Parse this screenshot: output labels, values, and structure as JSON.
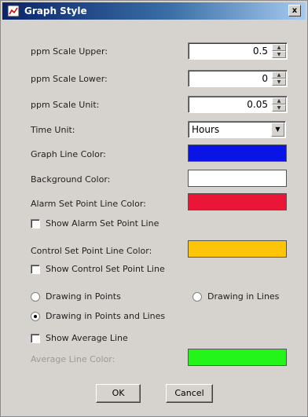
{
  "window": {
    "title": "Graph Style",
    "close_symbol": "x"
  },
  "fields": {
    "ppm_upper": {
      "label": "ppm Scale Upper:",
      "value": "0.5"
    },
    "ppm_lower": {
      "label": "ppm Scale Lower:",
      "value": "0"
    },
    "ppm_unit": {
      "label": "ppm Scale Unit:",
      "value": "0.05"
    },
    "time_unit": {
      "label": "Time Unit:",
      "value": "Hours"
    }
  },
  "colors": {
    "graph_line": {
      "label": "Graph Line Color:",
      "color": "#0a14e6"
    },
    "background": {
      "label": "Background Color:",
      "color": "#ffffff"
    },
    "alarm_line": {
      "label": "Alarm Set Point Line Color:",
      "color": "#ea1638"
    },
    "control_line": {
      "label": "Control Set Point Line Color:",
      "color": "#fec408"
    },
    "average_line": {
      "label": "Average Line Color:",
      "color": "#23f51b"
    }
  },
  "checks": {
    "show_alarm": {
      "label": "Show Alarm Set Point Line",
      "checked": false
    },
    "show_control": {
      "label": "Show Control Set Point Line",
      "checked": false
    },
    "show_average": {
      "label": "Show Average Line",
      "checked": false
    }
  },
  "radios": {
    "points": {
      "label": "Drawing in Points",
      "selected": false
    },
    "lines": {
      "label": "Drawing in Lines",
      "selected": false
    },
    "points_lines": {
      "label": "Drawing in Points and Lines",
      "selected": true
    }
  },
  "buttons": {
    "ok": "OK",
    "cancel": "Cancel"
  }
}
